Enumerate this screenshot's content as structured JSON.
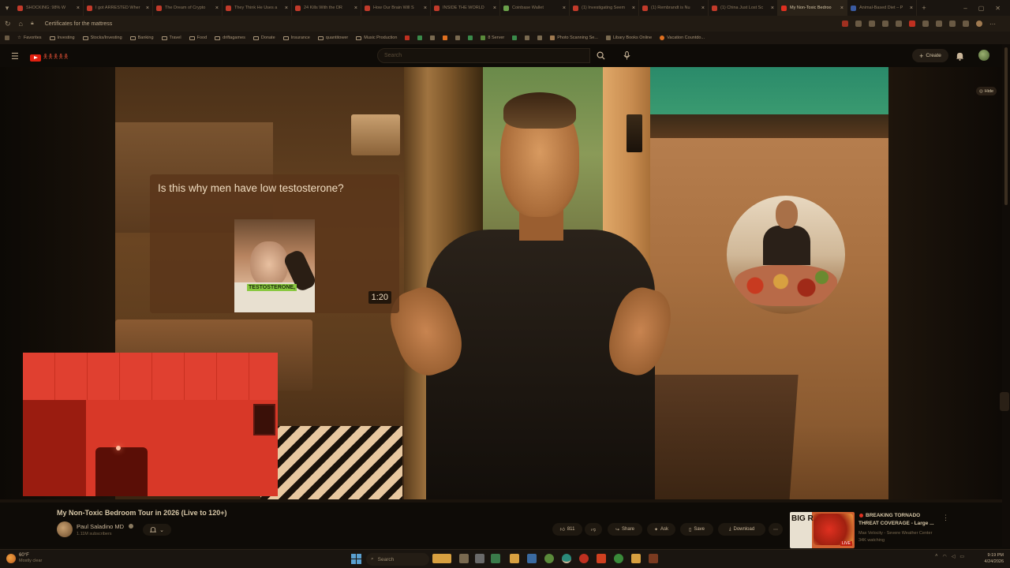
{
  "browser": {
    "tabs": [
      {
        "label": "SHOCKING: 98% W"
      },
      {
        "label": "I got ARRESTED Wher"
      },
      {
        "label": "The Dream of Crypto"
      },
      {
        "label": "They Think He Uses a"
      },
      {
        "label": "24 Kills With the DR"
      },
      {
        "label": "How Our Brain Will S"
      },
      {
        "label": "INSIDE THE WORLD"
      },
      {
        "label": "Coinbase Wallet"
      },
      {
        "label": "(1) Investigating Seem"
      },
      {
        "label": "(1) Rembrandt is Nu"
      },
      {
        "label": "(1) China Just Lost Sc"
      },
      {
        "label": "My Non-Toxic Bedroo"
      },
      {
        "label": "Animal-Based Diet – P"
      }
    ],
    "new_tab": "+",
    "address": "Certificates for the mattress",
    "favorites": [
      {
        "label": "Favorites"
      },
      {
        "label": "Investing"
      },
      {
        "label": "Stocks/Investing"
      },
      {
        "label": "Banking"
      },
      {
        "label": "Travel"
      },
      {
        "label": "Food"
      },
      {
        "label": "driftagames"
      },
      {
        "label": "Donate"
      },
      {
        "label": "Insurance"
      },
      {
        "label": "quantitower"
      },
      {
        "label": "Music Production"
      },
      {
        "label": "8 Server"
      },
      {
        "label": "Photo Scanning Se..."
      },
      {
        "label": "Libary Books Online"
      },
      {
        "label": "Vacation Countdo..."
      }
    ]
  },
  "yt": {
    "search_placeholder": "Search",
    "create_label": "Create",
    "hide_label": "Hide",
    "card": {
      "title": "Is this why men have low testosterone?",
      "caption": "TESTOSTERONE,",
      "duration": "1:20"
    },
    "video": {
      "title": "My Non-Toxic Bedroom Tour in 2026 (Live to 120+)",
      "channel": "Paul Saladino MD",
      "subscribers": "1.11M subscribers",
      "likes": "811",
      "share": "Share",
      "ask": "Ask",
      "save": "Save",
      "download": "Download",
      "more": "⋯"
    },
    "recommended": {
      "thumb_text": "BIG RISK",
      "thumb_badge": "LIVE",
      "title": "BREAKING TORNADO THREAT COVERAGE - Large ...",
      "channel": "Max Velocity - Severe Weather Center",
      "watching": "34K watching"
    }
  },
  "taskbar": {
    "weather_temp": "60°F",
    "weather_cond": "Mostly clear",
    "search_label": "Search",
    "time": "9:19 PM",
    "date": "4/24/2026"
  }
}
